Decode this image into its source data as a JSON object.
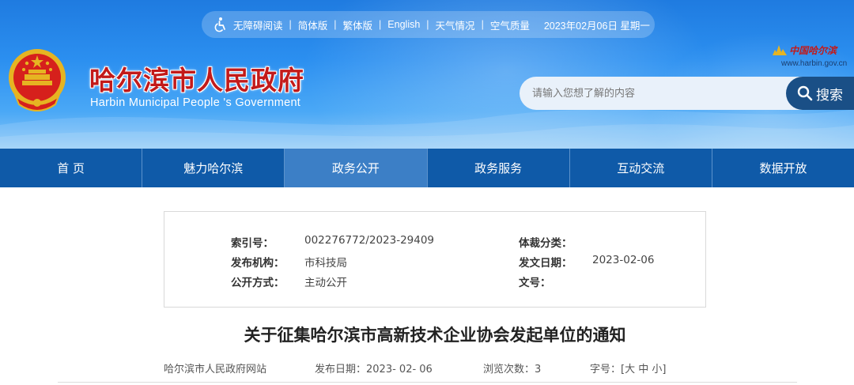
{
  "topbar": {
    "items": [
      "无障碍阅读",
      "简体版",
      "繁体版",
      "English",
      "天气情况",
      "空气质量"
    ],
    "separator": "|",
    "date": "2023年02月06日 星期一"
  },
  "header": {
    "title": "哈尔滨市人民政府",
    "subtitle": "Harbin Municipal People 's Government",
    "brand_name": "中国哈尔滨",
    "brand_url": "www.harbin.gov.cn",
    "emblem_icon": "national-emblem-icon"
  },
  "search": {
    "placeholder": "请输入您想了解的内容",
    "button_label": "搜索"
  },
  "nav": {
    "items": [
      "首 页",
      "魅力哈尔滨",
      "政务公开",
      "政务服务",
      "互动交流",
      "数据开放"
    ],
    "active_index": 2
  },
  "meta": {
    "rows": [
      {
        "k1": "索引号：",
        "v1": "002276772/2023-29409",
        "k2": "体裁分类：",
        "v2": ""
      },
      {
        "k1": "发布机构：",
        "v1": "市科技局",
        "k2": "发文日期：",
        "v2": "2023-02-06"
      },
      {
        "k1": "公开方式：",
        "v1": "主动公开",
        "k2": "文号：",
        "v2": ""
      }
    ]
  },
  "article": {
    "title": "关于征集哈尔滨市高新技术企业协会发起单位的通知",
    "source": "哈尔滨市人民政府网站",
    "publish_label": "发布日期：",
    "publish_date": "2023- 02- 06",
    "views_label": "浏览次数：",
    "views_count": "3",
    "fontsize_label": "字号：",
    "fontsize_open": "[",
    "fontsize_options": [
      "大",
      "中",
      "小"
    ],
    "fontsize_close": "]"
  },
  "colors": {
    "nav_bg": "#0f5aa8",
    "nav_active": "#3c7fc6",
    "title_red": "#c21a1a",
    "search_button": "#1a4f86"
  }
}
